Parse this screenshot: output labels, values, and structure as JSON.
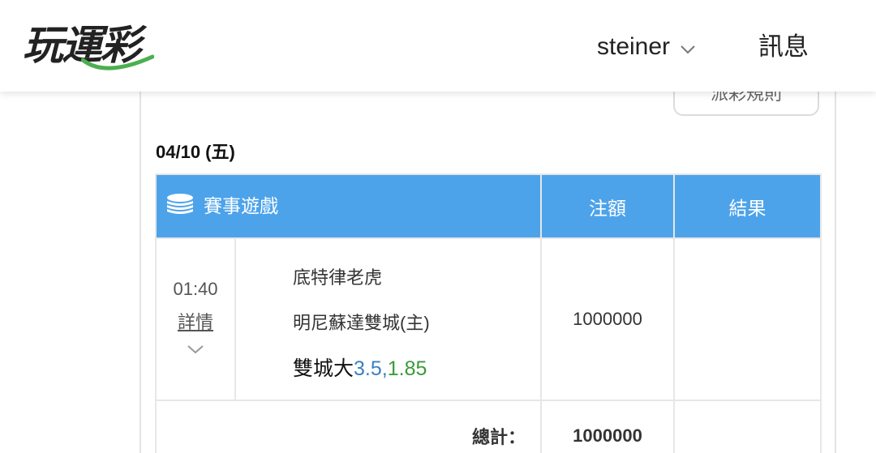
{
  "header": {
    "logo_text": "玩運彩",
    "username": "steiner",
    "messages_label": "訊息"
  },
  "toolbar": {
    "rules_button_label": "派彩規則"
  },
  "bets": {
    "date": "04/10 (五)",
    "columns": {
      "game": "賽事遊戲",
      "amount": "注額",
      "result": "結果"
    },
    "rows": [
      {
        "time": "01:40",
        "detail_label": "詳情",
        "away_team": "底特律老虎",
        "home_team": "明尼蘇達雙城(主)",
        "pick_label": "雙城大",
        "pick_line": "3.5",
        "pick_separator": ",",
        "pick_odds": "1.85",
        "amount": "1000000",
        "result": ""
      }
    ],
    "total_label": "總計：",
    "total_amount": "1000000"
  },
  "colors": {
    "header_blue": "#4da3ea",
    "line_blue": "#3a7fc4",
    "odds_green": "#3a9b3a",
    "logo_green": "#4caf50"
  }
}
